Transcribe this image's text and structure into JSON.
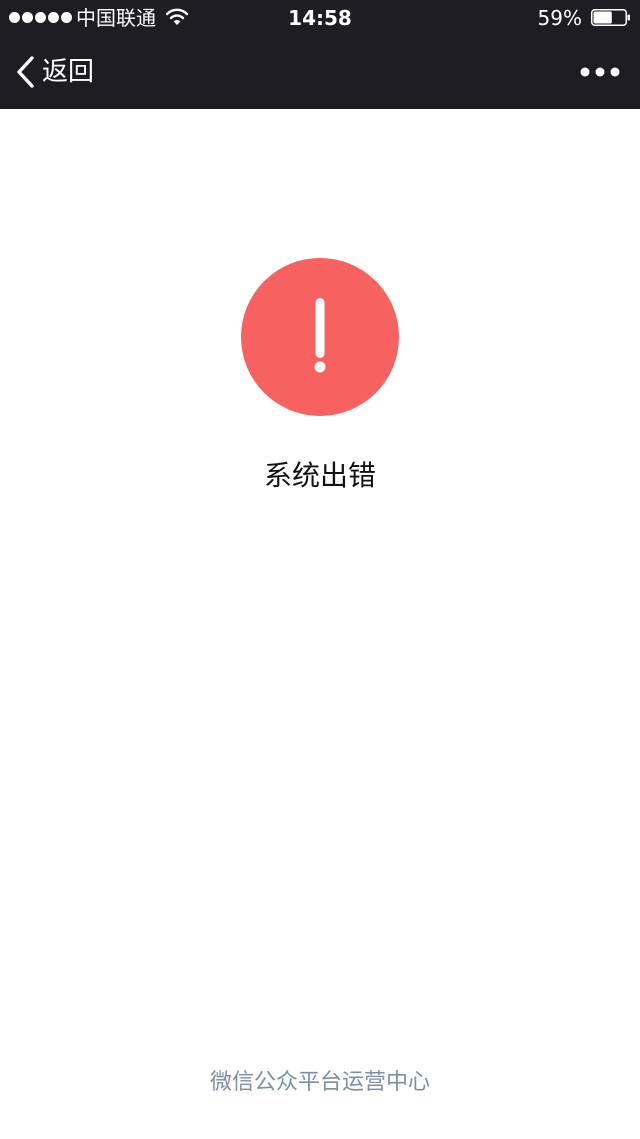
{
  "status_bar": {
    "carrier": "中国联通",
    "time": "14:58",
    "battery": "59%",
    "battery_level": 0.59,
    "signal_strength": 5,
    "icons": [
      "signal-dots-icon",
      "wifi-icon",
      "battery-icon"
    ]
  },
  "nav": {
    "back_label": "返回",
    "icons": [
      "chevron-left-icon",
      "more-dots-icon"
    ]
  },
  "error": {
    "icon": "exclamation-icon",
    "icon_color": "#f76260",
    "message": "系统出错"
  },
  "footer": {
    "link": "微信公众平台运营中心",
    "link_color": "#7d8ea6"
  },
  "colors": {
    "topbar": "#1e1e22",
    "background": "#ffffff"
  }
}
